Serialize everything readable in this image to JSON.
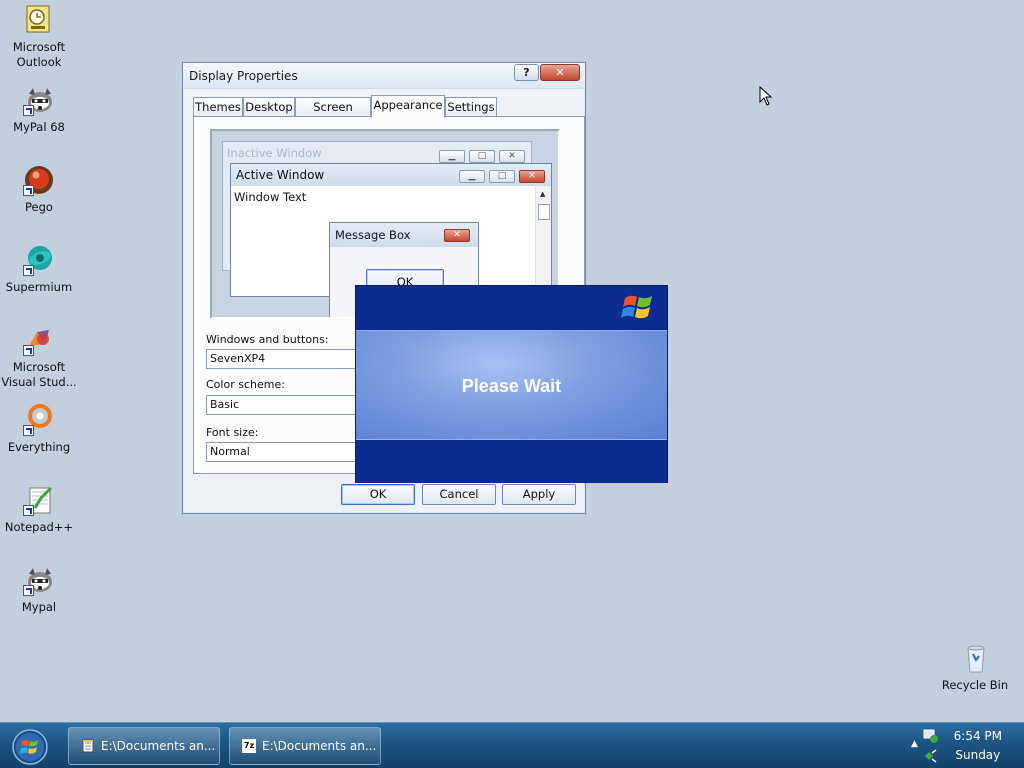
{
  "desktop": {
    "icons": [
      {
        "label": "Microsoft Outlook",
        "line1": "Microsoft",
        "line2": "Outlook",
        "icon": "outlook-icon"
      },
      {
        "label": "MyPal 68",
        "line1": "MyPal 68",
        "line2": "",
        "icon": "mypal-icon"
      },
      {
        "label": "Pego",
        "line1": "Pego",
        "line2": "",
        "icon": "pego-icon"
      },
      {
        "label": "Supermium",
        "line1": "Supermium",
        "line2": "",
        "icon": "supermium-icon"
      },
      {
        "label": "Microsoft Visual Stud...",
        "line1": "Microsoft",
        "line2": "Visual Stud...",
        "icon": "visual-studio-icon"
      },
      {
        "label": "Everything",
        "line1": "Everything",
        "line2": "",
        "icon": "everything-icon"
      },
      {
        "label": "Notepad++",
        "line1": "Notepad++",
        "line2": "",
        "icon": "notepadpp-icon"
      },
      {
        "label": "Mypal",
        "line1": "Mypal",
        "line2": "",
        "icon": "mypal-icon"
      }
    ],
    "recycle_bin": "Recycle Bin"
  },
  "display_properties": {
    "title": "Display Properties",
    "help_label": "?",
    "close_label": "✕",
    "tabs": [
      "Themes",
      "Desktop",
      "Screen Saver",
      "Appearance",
      "Settings"
    ],
    "active_tab": "Appearance",
    "preview": {
      "inactive_title": "Inactive Window",
      "active_title": "Active Window",
      "window_text": "Window Text",
      "message_box_title": "Message Box",
      "message_box_ok": "OK"
    },
    "windows_and_buttons_label": "Windows and buttons:",
    "windows_and_buttons_value": "SevenXP4",
    "color_scheme_label": "Color scheme:",
    "color_scheme_value": "Basic",
    "font_size_label": "Font size:",
    "font_size_value": "Normal",
    "ok_label": "OK",
    "cancel_label": "Cancel",
    "apply_label": "Apply"
  },
  "splash": {
    "message": "Please Wait"
  },
  "taskbar": {
    "buttons": [
      {
        "label": "E:\\Documents an...",
        "icon": "notepad-icon"
      },
      {
        "label": "E:\\Documents an...",
        "icon": "7zip-icon"
      }
    ],
    "clock_time": "6:54 PM",
    "clock_day": "Sunday",
    "sevenzip_icon_text": "7z"
  },
  "colors": {
    "desktop_bg": "#c4cfdd",
    "taskbar": "#1c5482",
    "splash_blue": "#0c2c92",
    "close_red": "#c3462e"
  }
}
